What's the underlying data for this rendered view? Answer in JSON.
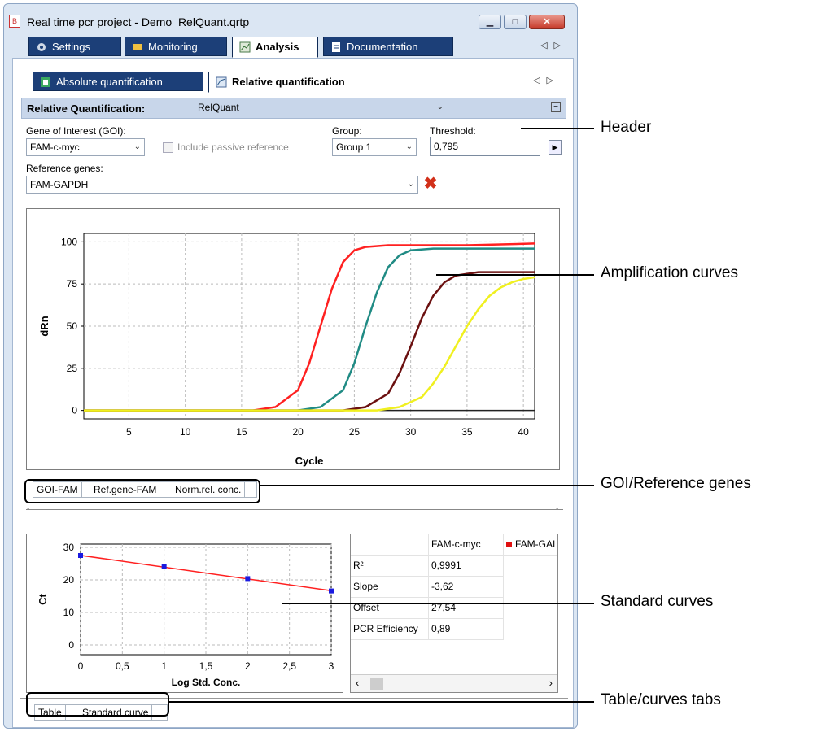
{
  "window": {
    "title": "Real time pcr project - Demo_RelQuant.qrtp",
    "min_symbol": "▁",
    "max_symbol": "□",
    "close_symbol": "✕"
  },
  "main_tabs": [
    "Settings",
    "Monitoring",
    "Analysis",
    "Documentation"
  ],
  "sub_tabs": [
    "Absolute quantification",
    "Relative quantification"
  ],
  "section": {
    "label": "Relative Quantification:",
    "value": "RelQuant"
  },
  "form": {
    "goi_label": "Gene of Interest (GOI):",
    "goi_value": "FAM-c-myc",
    "passive_label": "Include passive reference",
    "group_label": "Group:",
    "group_value": "Group 1",
    "threshold_label": "Threshold:",
    "threshold_value": "0,795",
    "ref_label": "Reference genes:",
    "ref_value": "FAM-GAPDH"
  },
  "chart_data": [
    {
      "type": "line",
      "title": "",
      "xlabel": "Cycle",
      "ylabel": "dRn",
      "xlim": [
        1,
        41
      ],
      "ylim": [
        -5,
        105
      ],
      "xticks": [
        5,
        10,
        15,
        20,
        25,
        30,
        35,
        40
      ],
      "yticks": [
        0,
        25,
        50,
        75,
        100
      ],
      "grid": true,
      "series": [
        {
          "color": "#ff2020",
          "x": [
            1,
            16,
            18,
            20,
            21,
            22,
            23,
            24,
            25,
            26,
            28,
            30,
            35,
            41
          ],
          "y": [
            0,
            0,
            2,
            12,
            28,
            50,
            72,
            88,
            95,
            97,
            98,
            98,
            98,
            99
          ]
        },
        {
          "color": "#208b84",
          "x": [
            1,
            20,
            22,
            24,
            25,
            26,
            27,
            28,
            29,
            30,
            32,
            35,
            41
          ],
          "y": [
            0,
            0,
            2,
            12,
            28,
            50,
            70,
            85,
            92,
            95,
            96,
            96,
            96
          ]
        },
        {
          "color": "#6b1010",
          "x": [
            1,
            24,
            26,
            28,
            29,
            30,
            31,
            32,
            33,
            34,
            36,
            38,
            41
          ],
          "y": [
            0,
            0,
            2,
            10,
            22,
            38,
            55,
            68,
            76,
            80,
            82,
            82,
            82
          ]
        },
        {
          "color": "#f0f020",
          "x": [
            1,
            27,
            29,
            31,
            32,
            33,
            34,
            35,
            36,
            37,
            38,
            39,
            40,
            41
          ],
          "y": [
            0,
            0,
            2,
            8,
            16,
            26,
            38,
            50,
            60,
            68,
            73,
            76,
            78,
            79
          ]
        }
      ],
      "threshold_y": 0
    },
    {
      "type": "scatter",
      "title": "",
      "xlabel": "Log Std. Conc.",
      "ylabel": "Ct",
      "xlim": [
        0,
        3
      ],
      "ylim": [
        -3,
        31
      ],
      "xticks": [
        "0",
        "0,5",
        "1",
        "1,5",
        "2",
        "2,5",
        "3"
      ],
      "yticks": [
        0,
        10,
        20,
        30
      ],
      "grid": true,
      "points": {
        "x": [
          0,
          1,
          2,
          3
        ],
        "y": [
          27.5,
          24.1,
          20.4,
          16.6
        ]
      },
      "fit_line": {
        "x": [
          0,
          3
        ],
        "y": [
          27.54,
          16.68
        ]
      }
    }
  ],
  "bottom_tabs_gene": [
    "GOI-FAM",
    "Ref.gene-FAM",
    "Norm.rel. conc."
  ],
  "stats_table": {
    "columns": [
      "FAM-c-myc",
      "FAM-GAI"
    ],
    "rows": [
      {
        "label": "R²",
        "value": "0,9991"
      },
      {
        "label": "Slope",
        "value": "-3,62"
      },
      {
        "label": "Offset",
        "value": "27,54"
      },
      {
        "label": "PCR Efficiency",
        "value": "0,89"
      }
    ]
  },
  "bottom_tabs_view": [
    "Table",
    "Standard curve"
  ],
  "callouts": {
    "header": "Header",
    "amplification": "Amplification curves",
    "goi_ref": "GOI/Reference genes",
    "standard": "Standard curves",
    "tabs": "Table/curves tabs"
  },
  "colors": {
    "tab_dark": "#1c3f78",
    "section_bg": "#c8d6ea",
    "window_bg": "#dbe6f3"
  }
}
